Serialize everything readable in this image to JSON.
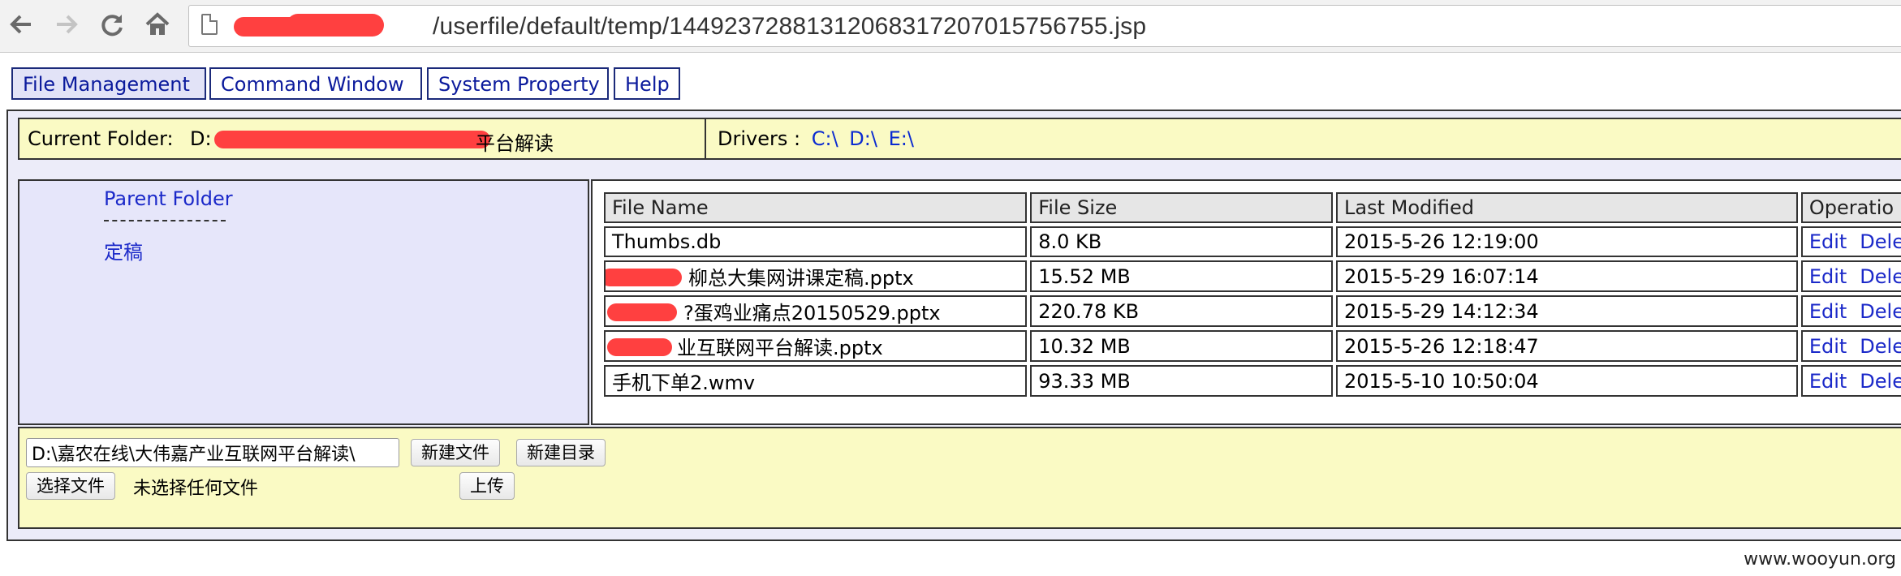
{
  "browser": {
    "back_icon": "arrow-left-icon",
    "forward_icon": "arrow-right-icon",
    "reload_icon": "reload-icon",
    "home_icon": "home-icon",
    "url_path": "/userfile/default/temp/14492372881312068317207015756755.jsp"
  },
  "menu": {
    "items": [
      {
        "label": "File Management"
      },
      {
        "label": "Command Window"
      },
      {
        "label": "System Property"
      },
      {
        "label": "Help"
      }
    ]
  },
  "folder_bar": {
    "current_label": "Current Folder:",
    "current_value_prefix": "D:",
    "current_value_suffix": "平台解读",
    "drivers_label": "Drivers :",
    "drives": [
      "C:\\",
      "D:\\",
      "E:\\"
    ]
  },
  "left_pane": {
    "parent_link": "Parent Folder",
    "folders": [
      "定稿"
    ]
  },
  "file_table": {
    "headers": [
      "File Name",
      "File Size",
      "Last Modified",
      "Operatio"
    ],
    "op_labels": {
      "edit": "Edit",
      "delete": "Dele"
    },
    "rows": [
      {
        "name": "Thumbs.db",
        "size": "8.0 KB",
        "modified": "2015-5-26 12:19:00"
      },
      {
        "name": "柳总大集网讲课定稿.pptx",
        "size": "15.52 MB",
        "modified": "2015-5-29 16:07:14"
      },
      {
        "name": "?蛋鸡业痛点20150529.pptx",
        "size": "220.78 KB",
        "modified": "2015-5-29 14:12:34"
      },
      {
        "name": "业互联网平台解读.pptx",
        "size": "10.32 MB",
        "modified": "2015-5-26 12:18:47"
      },
      {
        "name": "手机下单2.wmv",
        "size": "93.33 MB",
        "modified": "2015-5-10 10:50:04"
      }
    ]
  },
  "bottom_bar": {
    "path_value": "D:\\嘉农在线\\大伟嘉产业互联网平台解读\\",
    "new_file_label": "新建文件",
    "new_dir_label": "新建目录",
    "choose_file_label": "选择文件",
    "no_file_text": "未选择任何文件",
    "upload_label": "上传"
  },
  "footer": {
    "watermark": "www.wooyun.org"
  },
  "colors": {
    "link": "#1b29c9",
    "panel_yellow": "#fafac4",
    "panel_lavender": "#e6e6fa",
    "redaction": "#ff4040"
  }
}
